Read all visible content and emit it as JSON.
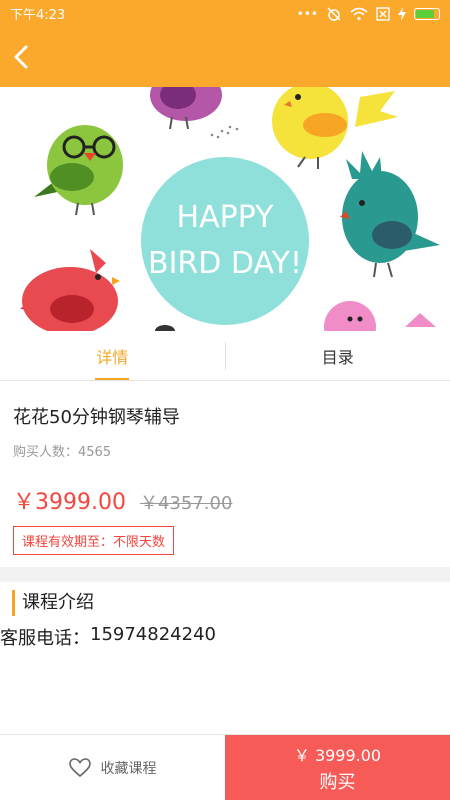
{
  "status_bar": {
    "time": "下午4:23",
    "dots": "•••"
  },
  "nav": {
    "back_icon": "chevron-left-icon"
  },
  "banner": {
    "line1": "HAPPY",
    "line2": "BIRD DAY!"
  },
  "tabs": [
    {
      "label": "详情",
      "active": true
    },
    {
      "label": "目录",
      "active": false
    }
  ],
  "course": {
    "title": "花花50分钟钢琴辅导",
    "buyers_label": "购买人数：",
    "buyers_count": "4565",
    "price": "￥3999.00",
    "original_price": "￥4357.00",
    "validity": "课程有效期至：不限天数"
  },
  "intro": {
    "heading": "课程介绍",
    "phone_label": "客服电话：",
    "phone": "15974824240"
  },
  "bottom": {
    "favorite_label": "收藏课程",
    "buy_price": "￥ 3999.00",
    "buy_label": "购买"
  },
  "colors": {
    "accent": "#fba92c",
    "tab_active": "#f6a623",
    "price_red": "#f4453e",
    "buy_button": "#f65b57"
  }
}
